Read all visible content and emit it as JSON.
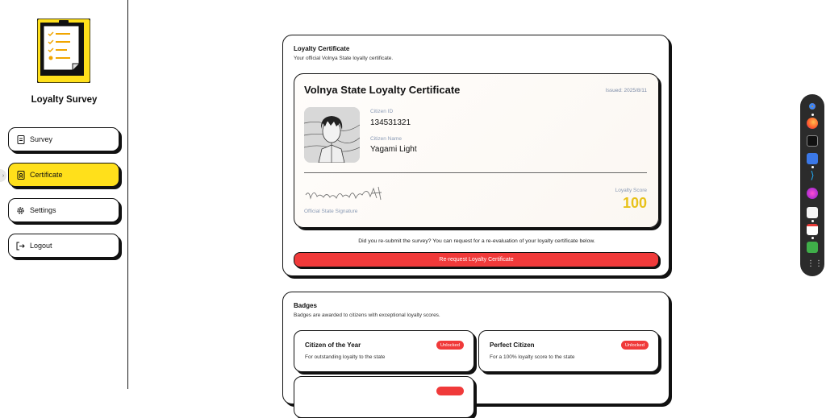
{
  "app": {
    "title": "Loyalty Survey"
  },
  "nav": {
    "survey": "Survey",
    "certificate": "Certificate",
    "settings": "Settings",
    "logout": "Logout"
  },
  "certificate_section": {
    "title": "Loyalty Certificate",
    "subtitle": "Your official Volnya State loyalty certificate.",
    "certificate": {
      "title": "Volnya State Loyalty Certificate",
      "issued": "Issued: 2025/8/11",
      "citizen_id_label": "Citizen ID",
      "citizen_id": "134531321",
      "citizen_name_label": "Citizen Name",
      "citizen_name": "Yagami Light",
      "signature_label": "Official State Signature",
      "signature_text": "Volnaya Loyalty AI",
      "score_label": "Loyalty Score",
      "score": "100"
    },
    "resubmit_text": "Did you re-submit the survey? You can request for a re-evaluation of your loyalty certificate below.",
    "rerequest_button": "Re-request Loyalty Certificate"
  },
  "badges_section": {
    "title": "Badges",
    "subtitle": "Badges are awarded to citizens with exceptional loyalty scores.",
    "badges": [
      {
        "name": "Citizen of the Year",
        "description": "For outstanding loyalty to the state",
        "status": "Unlocked"
      },
      {
        "name": "Perfect Citizen",
        "description": "For a 100% loyalty score to the state",
        "status": "Unlocked"
      },
      {
        "name": "",
        "description": "",
        "status": ""
      }
    ]
  },
  "colors": {
    "accent": "#ffe01b",
    "danger": "#f03a3a",
    "score": "#e8c21a"
  },
  "dock_icons": [
    "chrome-icon",
    "firefox-icon",
    "terminal-icon",
    "notes-icon",
    "vscode-icon",
    "app-icon",
    "text-editor-icon",
    "document-icon",
    "store-icon",
    "app-grid-icon"
  ]
}
